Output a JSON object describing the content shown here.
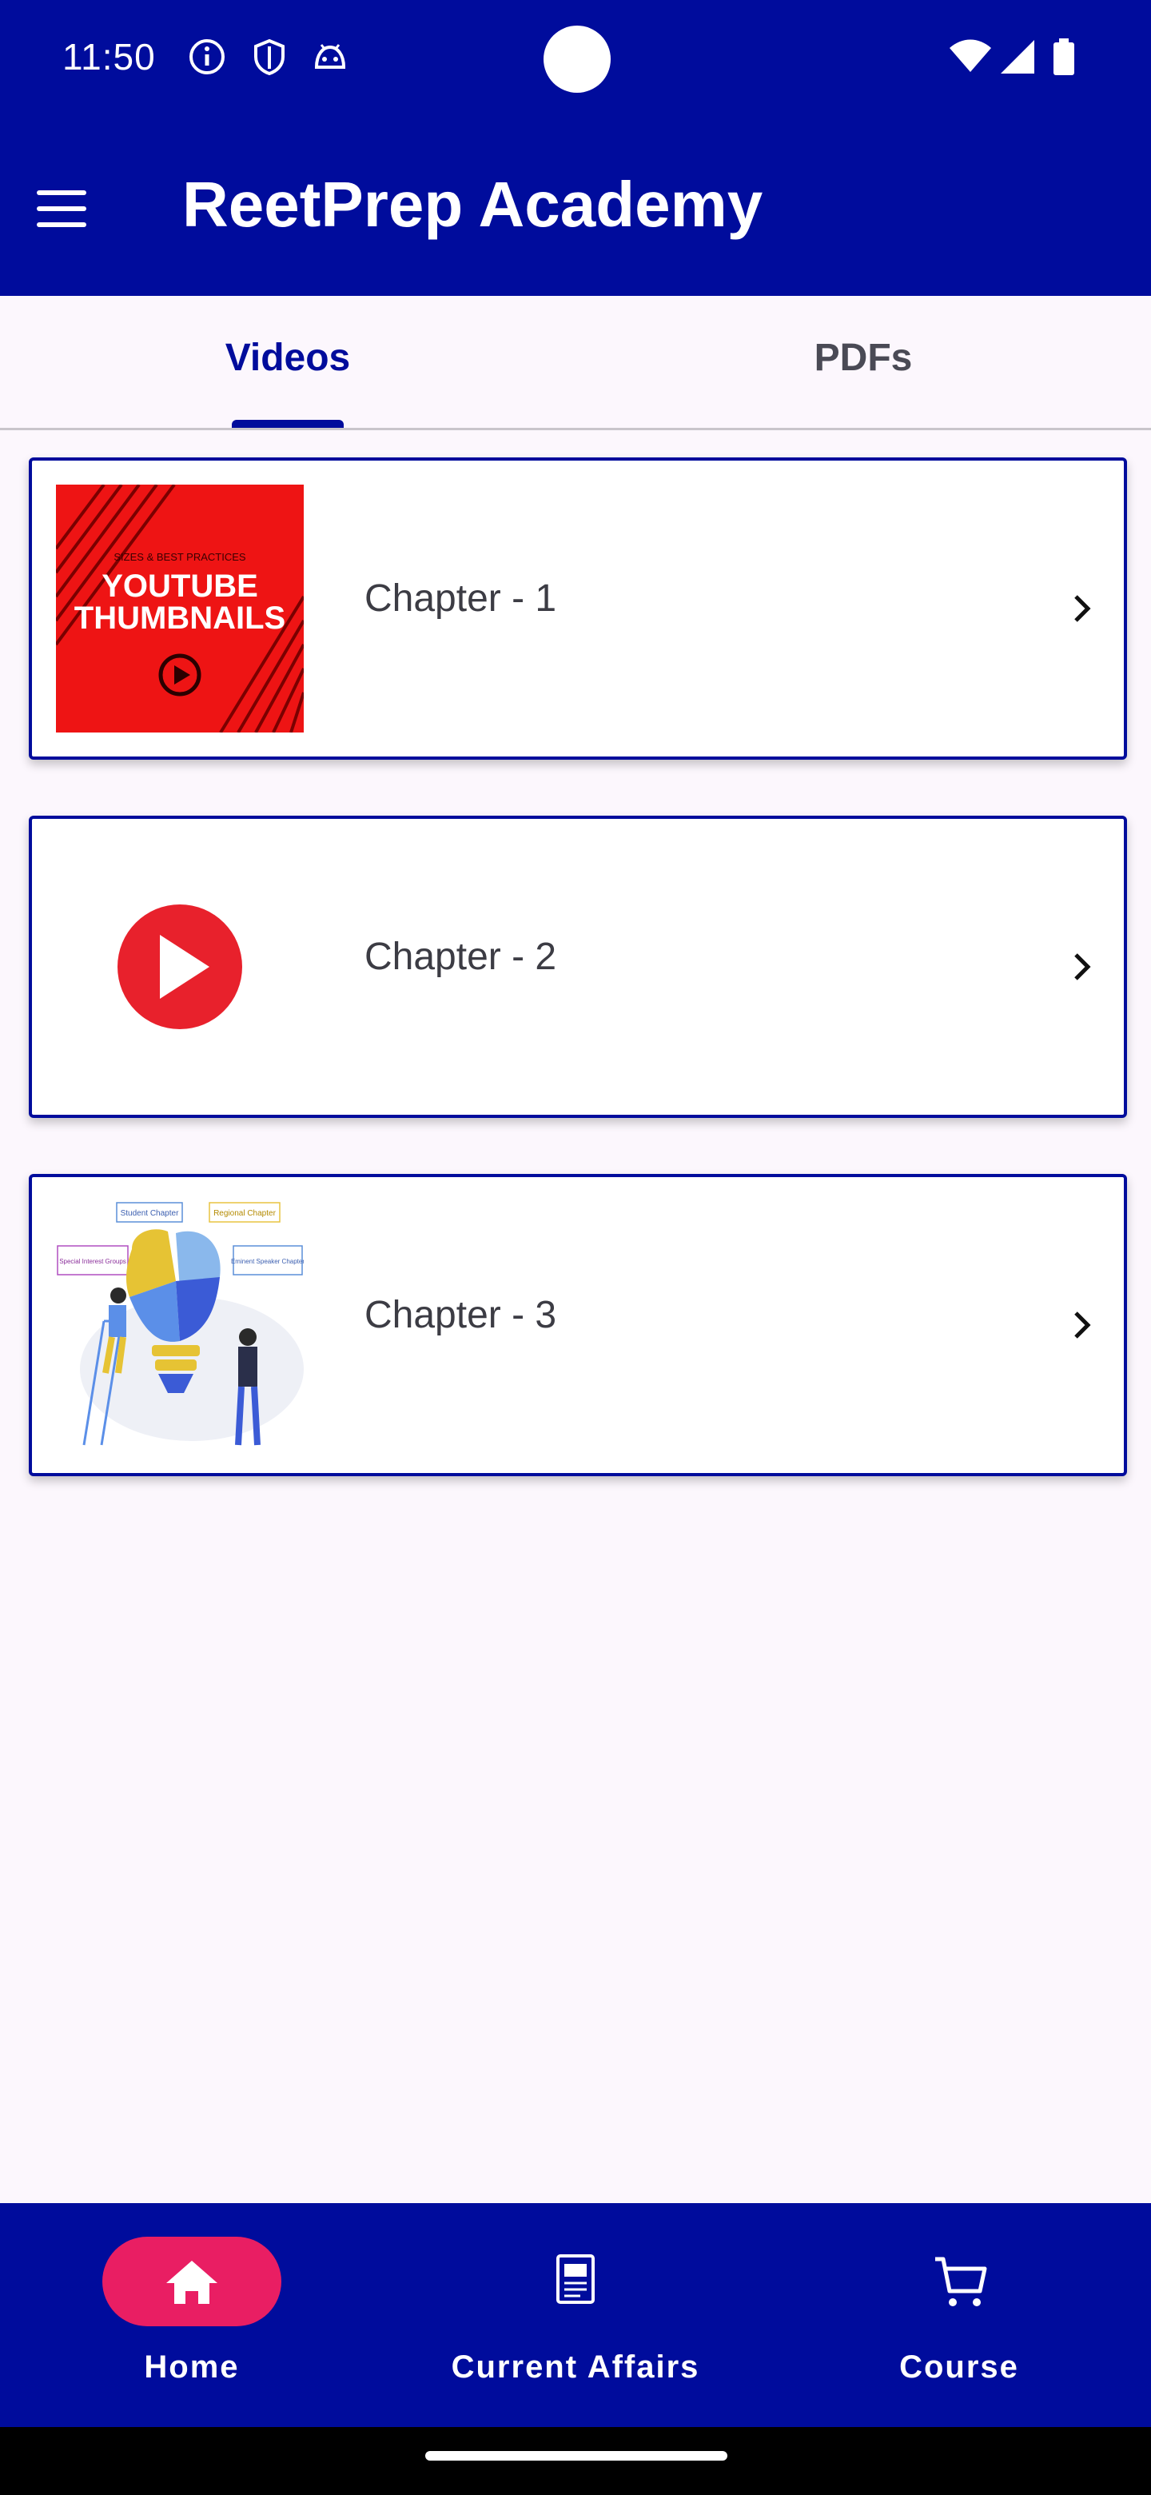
{
  "status_bar": {
    "time": "11:50",
    "icons": [
      "info-icon",
      "shield-icon",
      "android-icon",
      "wifi-icon",
      "signal-icon",
      "battery-icon"
    ]
  },
  "app_bar": {
    "title": "ReetPrep Academy",
    "menu_icon": "hamburger-menu-icon",
    "background": "#000c9c"
  },
  "tabs": [
    {
      "label": "Videos",
      "active": true
    },
    {
      "label": "PDFs",
      "active": false
    }
  ],
  "chapters": [
    {
      "title": "Chapter - 1",
      "thumbnail": {
        "kind": "youtube-thumbnails-graphic",
        "caption_small": "SIZES & BEST PRACTICES",
        "caption_line1": "YOUTUBE",
        "caption_line2": "THUMBNAILS"
      }
    },
    {
      "title": "Chapter - 2",
      "thumbnail": {
        "kind": "red-play-button"
      }
    },
    {
      "title": "Chapter - 3",
      "thumbnail": {
        "kind": "lightbulb-puzzle-illustration",
        "labels": [
          "Student Chapter",
          "Regional Chapter",
          "Special Interest Groups",
          "Eminent Speaker Chapter"
        ]
      }
    }
  ],
  "bottom_nav": [
    {
      "label": "Home",
      "icon": "home-icon",
      "active": true
    },
    {
      "label": "Current Affairs",
      "icon": "newspaper-icon",
      "active": false
    },
    {
      "label": "Course",
      "icon": "cart-icon",
      "active": false
    }
  ],
  "colors": {
    "primary": "#000c9c",
    "accent": "#e91e63",
    "background": "#fcf7fd"
  }
}
